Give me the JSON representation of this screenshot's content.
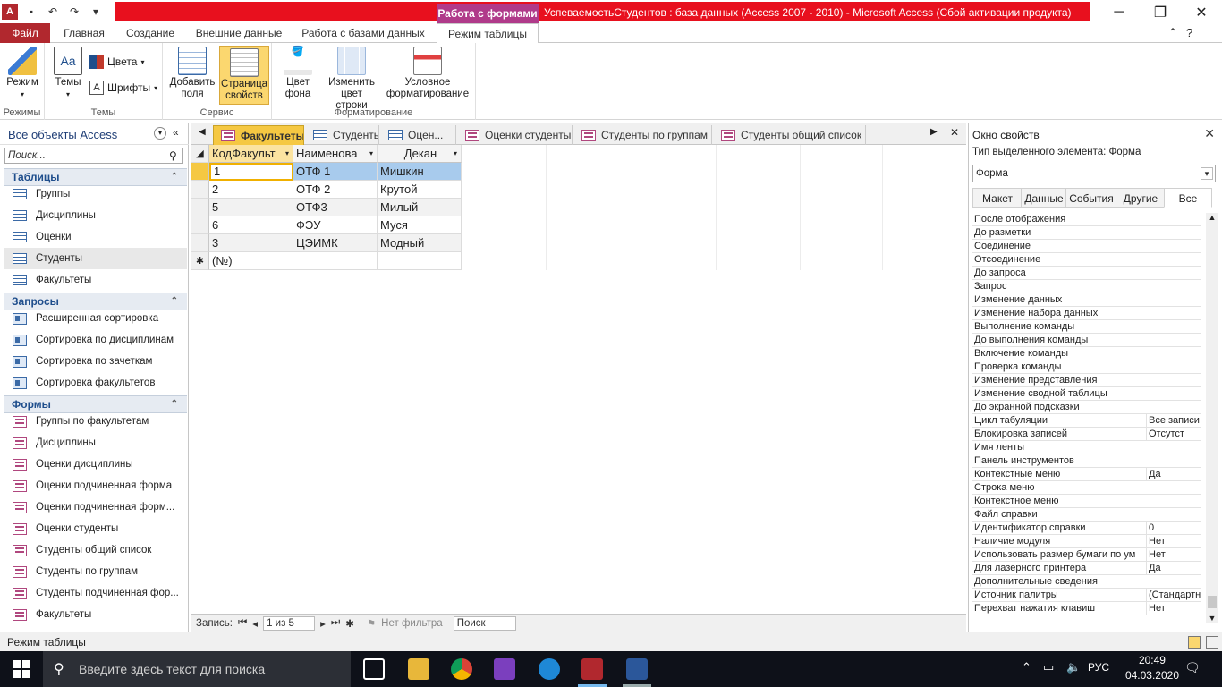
{
  "window": {
    "context_tab_header": "Работа с формами",
    "title": "УспеваемостьСтудентов : база данных (Access 2007 - 2010)  -  Microsoft Access (Сбой активации продукта)"
  },
  "ribbon_tabs": [
    "Файл",
    "Главная",
    "Создание",
    "Внешние данные",
    "Работа с базами данных",
    "Режим таблицы"
  ],
  "ribbon": {
    "mode_label": "Режим",
    "themes_label": "Темы",
    "colors_label": "Цвета",
    "fonts_label": "Шрифты",
    "add_fields_label": "Добавить поля",
    "page_props_label": "Страница свойств",
    "fill_color_label": "Цвет фона",
    "row_color_label": "Изменить цвет строки",
    "cond_format_label": "Условное форматирование",
    "groups": {
      "modes": "Режимы",
      "themes": "Темы",
      "service": "Сервис",
      "formatting": "Форматирование"
    }
  },
  "nav": {
    "title": "Все объекты Access",
    "search_placeholder": "Поиск...",
    "sections": {
      "tables": {
        "label": "Таблицы",
        "items": [
          "Группы",
          "Дисциплины",
          "Оценки",
          "Студенты",
          "Факультеты"
        ]
      },
      "queries": {
        "label": "Запросы",
        "items": [
          "Расширенная сортировка",
          "Сортировка по дисциплинам",
          "Сортировка по зачеткам",
          "Сортировка факультетов"
        ]
      },
      "forms": {
        "label": "Формы",
        "items": [
          "Группы по факультетам",
          "Дисциплины",
          "Оценки дисциплины",
          "Оценки подчиненная форма",
          "Оценки подчиненная форм...",
          "Оценки студенты",
          "Студенты общий список",
          "Студенты по группам",
          "Студенты подчиненная фор...",
          "Факультеты"
        ]
      }
    }
  },
  "doc_tabs": [
    "Факультеты",
    "Студенты",
    "Оцен...",
    "Оценки студенты",
    "Студенты по группам",
    "Студенты общий список"
  ],
  "grid": {
    "columns": [
      "КодФакульт",
      "Наименова",
      "Декан"
    ],
    "rows": [
      [
        "1",
        "ОТФ 1",
        "Мишкин"
      ],
      [
        "2",
        "ОТФ 2",
        "Крутой"
      ],
      [
        "5",
        "ОТФ3",
        "Милый"
      ],
      [
        "6",
        "ФЭУ",
        "Муся"
      ],
      [
        "3",
        "ЦЭИМК",
        "Модный"
      ]
    ],
    "new_row": "(№)"
  },
  "record_nav": {
    "label": "Запись:",
    "position": "1 из 5",
    "filter": "Нет фильтра",
    "search": "Поиск"
  },
  "props": {
    "title": "Окно свойств",
    "selection_type": "Тип выделенного элемента:  Форма",
    "selected_object": "Форма",
    "tabs": [
      "Макет",
      "Данные",
      "События",
      "Другие",
      "Все"
    ],
    "rows": [
      [
        "После отображения",
        ""
      ],
      [
        "До разметки",
        ""
      ],
      [
        "Соединение",
        ""
      ],
      [
        "Отсоединение",
        ""
      ],
      [
        "До запроса",
        ""
      ],
      [
        "Запрос",
        ""
      ],
      [
        "Изменение данных",
        ""
      ],
      [
        "Изменение набора данных",
        ""
      ],
      [
        "Выполнение команды",
        ""
      ],
      [
        "До выполнения команды",
        ""
      ],
      [
        "Включение команды",
        ""
      ],
      [
        "Проверка команды",
        ""
      ],
      [
        "Изменение представления",
        ""
      ],
      [
        "Изменение сводной таблицы",
        ""
      ],
      [
        "До экранной подсказки",
        ""
      ],
      [
        "Цикл табуляции",
        "Все записи"
      ],
      [
        "Блокировка записей",
        "Отсутст"
      ],
      [
        "Имя ленты",
        ""
      ],
      [
        "Панель инструментов",
        ""
      ],
      [
        "Контекстные меню",
        "Да"
      ],
      [
        "Строка меню",
        ""
      ],
      [
        "Контекстное меню",
        ""
      ],
      [
        "Файл справки",
        ""
      ],
      [
        "Идентификатор справки",
        "0"
      ],
      [
        "Наличие модуля",
        "Нет"
      ],
      [
        "Использовать размер бумаги по ум",
        "Нет"
      ],
      [
        "Для лазерного принтера",
        "Да"
      ],
      [
        "Дополнительные сведения",
        ""
      ],
      [
        "Источник палитры",
        "(Стандартн"
      ],
      [
        "Перехват нажатия клавиш",
        "Нет"
      ]
    ]
  },
  "status": {
    "text": "Режим таблицы"
  },
  "taskbar": {
    "search_placeholder": "Введите здесь текст для поиска",
    "lang": "РУС",
    "time": "20:49",
    "date": "04.03.2020"
  },
  "colors": {
    "title_red": "#e8101e",
    "context_purple": "#b03a8a",
    "file_tab": "#b1282e",
    "active_doc_tab": "#f5c842"
  }
}
